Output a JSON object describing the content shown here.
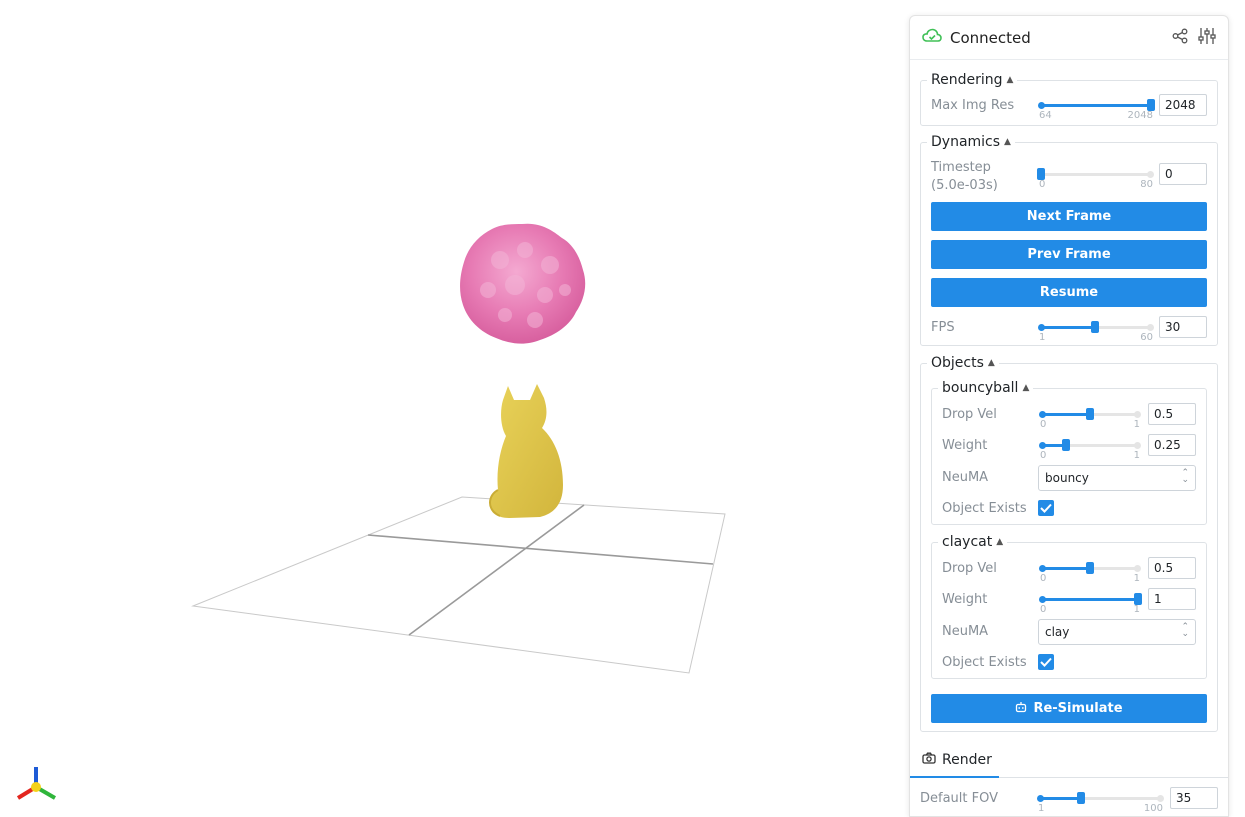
{
  "header": {
    "status": "Connected",
    "status_color": "#40c057",
    "share_icon": "share-icon",
    "settings_icon": "sliders-icon"
  },
  "rendering": {
    "title": "Rendering",
    "max_img_res": {
      "label": "Max Img Res",
      "min": "64",
      "max": "2048",
      "value": "2048",
      "fraction": 1.0
    }
  },
  "dynamics": {
    "title": "Dynamics",
    "timestep": {
      "label": "Timestep (5.0e-03s)",
      "min": "0",
      "max": "80",
      "value": "0",
      "fraction": 0.0
    },
    "next_frame": "Next Frame",
    "prev_frame": "Prev Frame",
    "resume": "Resume",
    "fps": {
      "label": "FPS",
      "min": "1",
      "max": "60",
      "value": "30",
      "fraction": 0.49
    }
  },
  "objects": {
    "title": "Objects",
    "bouncyball": {
      "title": "bouncyball",
      "drop_vel": {
        "label": "Drop Vel",
        "min": "0",
        "max": "1",
        "value": "0.5",
        "fraction": 0.5
      },
      "weight": {
        "label": "Weight",
        "min": "0",
        "max": "1",
        "value": "0.25",
        "fraction": 0.25
      },
      "neuma": {
        "label": "NeuMA",
        "value": "bouncy"
      },
      "exists": {
        "label": "Object Exists",
        "checked": true
      }
    },
    "claycat": {
      "title": "claycat",
      "drop_vel": {
        "label": "Drop Vel",
        "min": "0",
        "max": "1",
        "value": "0.5",
        "fraction": 0.5
      },
      "weight": {
        "label": "Weight",
        "min": "0",
        "max": "1",
        "value": "1",
        "fraction": 1.0
      },
      "neuma": {
        "label": "NeuMA",
        "value": "clay"
      },
      "exists": {
        "label": "Object Exists",
        "checked": true
      }
    },
    "resimulate": "Re-Simulate"
  },
  "tabs": {
    "render": "Render"
  },
  "render": {
    "default_fov": {
      "label": "Default FOV",
      "min": "1",
      "max": "100",
      "value": "35",
      "fraction": 0.34
    }
  },
  "colors": {
    "accent": "#228be6",
    "ball": "#e879b2",
    "cat": "#e3c84a"
  }
}
